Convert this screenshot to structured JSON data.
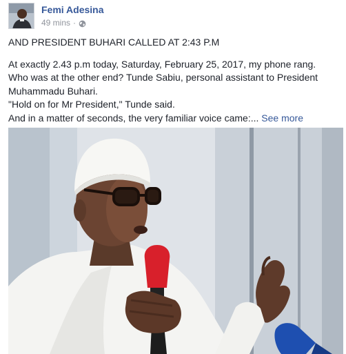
{
  "post": {
    "author": "Femi Adesina",
    "time": "49 mins",
    "separator": "·",
    "privacy_icon": "globe-icon",
    "title": "AND PRESIDENT BUHARI CALLED AT 2:43 P.M",
    "lines": [
      "At exactly 2.43 p.m today, Saturday, February 25, 2017, my phone rang.",
      "Who was at the other end? Tunde Sabiu, personal assistant to President",
      "Muhammadu Buhari.",
      "\"Hold on for Mr President,\" Tunde said."
    ],
    "last_line": "And in a matter of seconds, the very familiar voice came:...",
    "see_more": "See more"
  },
  "colors": {
    "link": "#365899",
    "text": "#1d2129",
    "muted": "#90949c"
  }
}
